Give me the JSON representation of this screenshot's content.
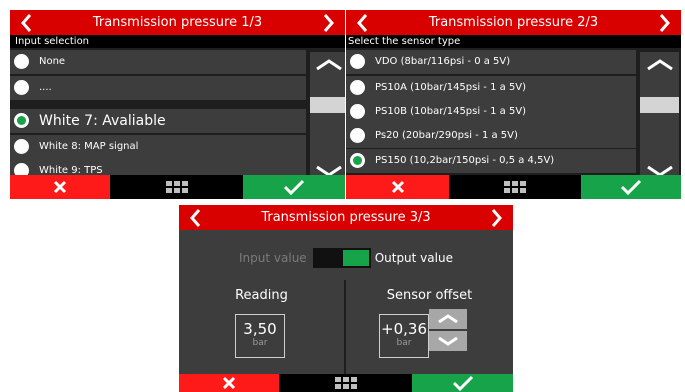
{
  "panel1": {
    "title": "Transmission pressure 1/3",
    "subtitle": "Input selection",
    "items": [
      {
        "label": "None",
        "selected": false
      },
      {
        "label": "....",
        "selected": false
      },
      {
        "label": "White 7: Avaliable",
        "selected": true
      },
      {
        "label": "White 8: MAP signal",
        "selected": false
      },
      {
        "label": "White 9: TPS",
        "selected": false
      }
    ]
  },
  "panel2": {
    "title": "Transmission pressure 2/3",
    "subtitle": "Select the sensor type",
    "items": [
      {
        "label": "VDO (8bar/116psi - 0 a 5V)",
        "selected": false
      },
      {
        "label": "PS10A (10bar/145psi - 1 a 5V)",
        "selected": false
      },
      {
        "label": "PS10B (10bar/145psi - 1 a 5V)",
        "selected": false
      },
      {
        "label": "Ps20 (20bar/290psi - 1 a 5V)",
        "selected": false
      },
      {
        "label": "PS150 (10,2bar/150psi - 0,5 a 4,5V)",
        "selected": true
      }
    ]
  },
  "panel3": {
    "title": "Transmission pressure 3/3",
    "toggle_left": "Input value",
    "toggle_right": "Output value",
    "toggle_state": "output",
    "reading_label": "Reading",
    "reading_value": "3,50",
    "reading_unit": "bar",
    "offset_label": "Sensor offset",
    "offset_value": "+0,36",
    "offset_unit": "bar"
  },
  "icons": {
    "back": "chevron-left-icon",
    "forward": "chevron-right-icon",
    "scroll_up": "chevron-up-icon",
    "scroll_down": "chevron-down-icon",
    "cancel": "x-icon",
    "menu": "grid-menu-icon",
    "confirm": "checkmark-icon"
  },
  "colors": {
    "header": "#d90000",
    "cancel": "#ff1a1a",
    "confirm": "#16a34a",
    "selected_radio": "#16a34a",
    "panel_bg": "#1e1e1e",
    "row_bg": "#3d3d3d"
  }
}
